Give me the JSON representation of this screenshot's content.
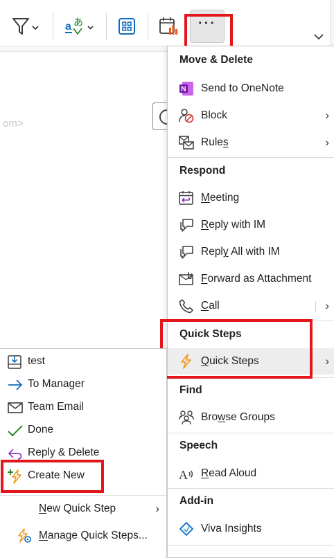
{
  "ribbon": {
    "more_label": "···",
    "icons": [
      "filter-icon",
      "translate-icon",
      "apps-icon",
      "calendar-chart-icon"
    ]
  },
  "menu": {
    "sections": {
      "move_delete": "Move & Delete",
      "respond": "Respond",
      "quick_steps": "Quick Steps",
      "find": "Find",
      "speech": "Speech",
      "add_in": "Add-in"
    },
    "items": {
      "send_onenote": "Send to OneNote",
      "block": "Block",
      "rules": "Rules",
      "meeting": "Meeting",
      "reply_im": "Reply with IM",
      "reply_all_im": "Reply All with IM",
      "forward_attachment": "Forward as Attachment",
      "call": "Call",
      "quick_steps": "Quick Steps",
      "browse_groups": "Browse Groups",
      "read_aloud": "Read Aloud",
      "viva_insights": "Viva Insights"
    },
    "chevron": "›"
  },
  "submenu": {
    "items": [
      "test",
      "To Manager",
      "Team Email",
      "Done",
      "Reply & Delete",
      "Create New"
    ],
    "new_quick_step": "New Quick Step",
    "manage_quick_steps": "Manage Quick Steps..."
  },
  "background": {
    "partial_text": "om>"
  },
  "colors": {
    "highlight_red": "#e3161c",
    "onenote_purple": "#7719aa",
    "quick_steps_orange": "#f29b22",
    "accent_blue": "#0f6cbd",
    "done_green": "#107c10",
    "reply_purple": "#8a3ab9"
  }
}
